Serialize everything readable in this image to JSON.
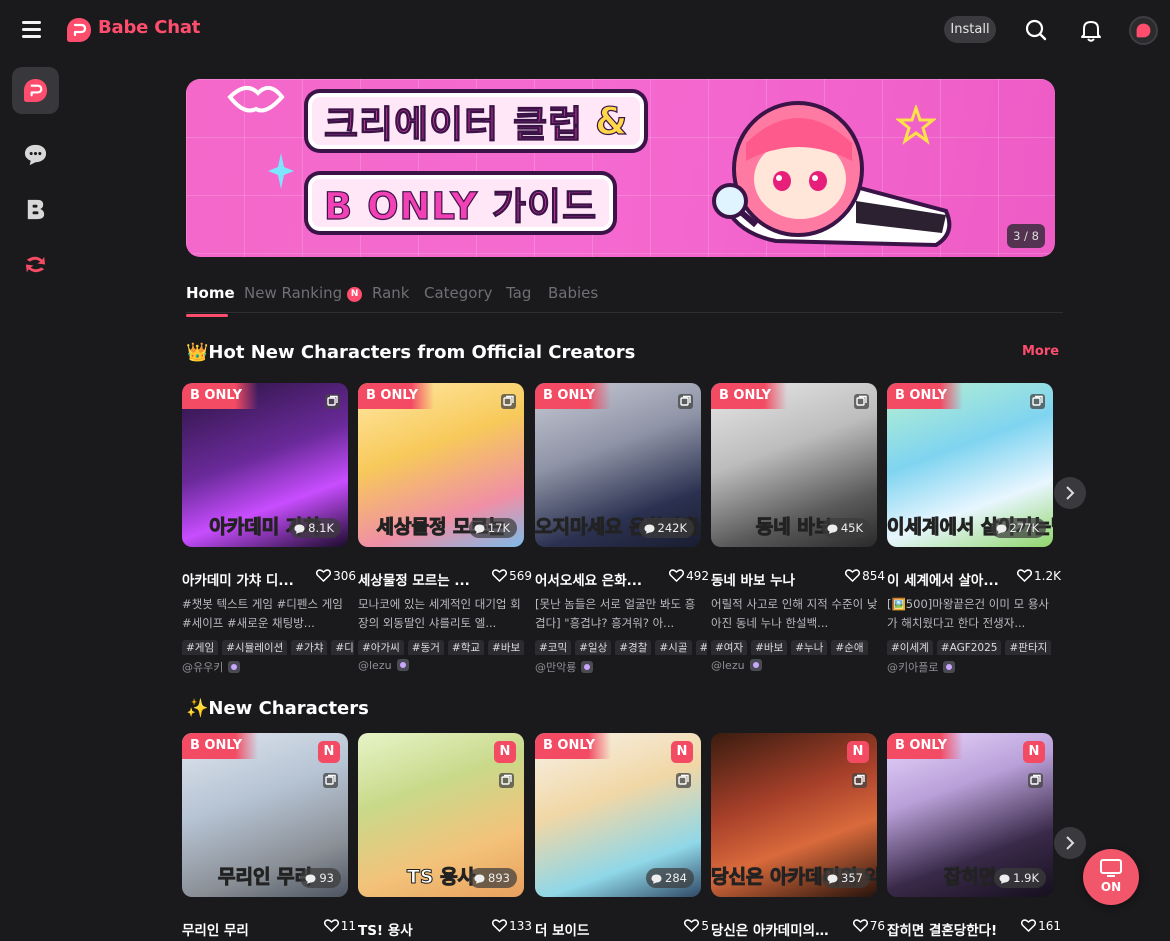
{
  "app": {
    "name": "Babe Chat",
    "install_label": "Install"
  },
  "banner": {
    "line1": "크리에이터 클럽",
    "amp": "&",
    "line2": "B ONLY 가이드",
    "counter": "3 / 8"
  },
  "tabs": [
    {
      "label": "Home",
      "active": true
    },
    {
      "label": "New Ranking",
      "badge": "N"
    },
    {
      "label": "Rank"
    },
    {
      "label": "Category"
    },
    {
      "label": "Tag"
    },
    {
      "label": "Babies"
    }
  ],
  "hot": {
    "title": "👑Hot New Characters from Official Creators",
    "more": "More",
    "cards": [
      {
        "bonly": "B ONLY",
        "caption": "아카데미 가챠",
        "chats": "8.1K",
        "title": "아카데미 가챠 디...",
        "likes": "306",
        "desc": "#챗봇 텍스트 게임 #디펜스 게임 #세이프 #새로운 채팅방...",
        "tags": [
          "#게임",
          "#시뮬레이션",
          "#가챠",
          "#디"
        ],
        "creator": "@유우키"
      },
      {
        "bonly": "B ONLY",
        "caption": "세상물정 모르는",
        "chats": "17K",
        "title": "세상물정 모르는 ...",
        "likes": "569",
        "desc": "모나코에 있는 세계적인 대기업 회장의 외동딸인 샤를리토 엘...",
        "tags": [
          "#아가씨",
          "#동거",
          "#학교",
          "#바보"
        ],
        "creator": "@lezu"
      },
      {
        "bonly": "B ONLY",
        "caption": "오지마세요 은화파출소",
        "chats": "242K",
        "title": "어서오세요 은화...",
        "likes": "492",
        "desc": "[못난 놈들은 서로 얼굴만 봐도 흥겹다] \"흥겹냐? 흥겨워? 아...",
        "tags": [
          "#코믹",
          "#일상",
          "#경찰",
          "#시골",
          "#"
        ],
        "creator": "@만악룡"
      },
      {
        "bonly": "B ONLY",
        "caption": "동네 바보",
        "chats": "45K",
        "title": "동네 바보 누나",
        "likes": "854",
        "desc": "어릴적 사고로 인해 지적 수준이 낮아진 동네 누나 한설백...",
        "tags": [
          "#여자",
          "#바보",
          "#누나",
          "#순애"
        ],
        "creator": "@lezu"
      },
      {
        "bonly": "B ONLY",
        "caption": "이세계에서 살아가는법",
        "chats": "277K",
        "title": "이 세계에서 살아...",
        "likes": "1.2K",
        "desc": "[🖼️500]마왕끝은건 이미 모 용사가 해치웠다고 한다 전생자...",
        "tags": [
          "#이세계",
          "#AGF2025",
          "#판타지"
        ],
        "creator": "@키아플로"
      }
    ]
  },
  "newchars": {
    "title": "✨New Characters",
    "cards": [
      {
        "bonly": "B ONLY",
        "new": "N",
        "caption": "무리인 무리",
        "chats": "93",
        "title": "무리인 무리",
        "likes": "11"
      },
      {
        "bonly": "",
        "new": "N",
        "caption": "TS 용사",
        "chats": "893",
        "title": "TS! 용사",
        "likes": "133"
      },
      {
        "bonly": "B ONLY",
        "new": "N",
        "caption": "",
        "chats": "284",
        "title": "더 보이드",
        "likes": "5"
      },
      {
        "bonly": "",
        "new": "N",
        "caption": "당신은 아카데미의 악역영애가 되었다",
        "chats": "357",
        "title": "당신은 아카데미의 ...",
        "likes": "76"
      },
      {
        "bonly": "B ONLY",
        "new": "N",
        "caption": "잡히면",
        "chats": "1.9K",
        "title": "잡히면 결혼당한다!",
        "likes": "161"
      }
    ]
  },
  "fab": {
    "label": "ON"
  },
  "colors": {
    "accent": "#ff4d6d",
    "background": "#1a1a1d",
    "banner": "#f56ad0"
  },
  "icons": {
    "menu": "hamburger-icon",
    "search": "search-icon",
    "bell": "bell-icon",
    "chat": "chat-bubble-icon",
    "next": "chevron-right-icon",
    "gallery": "gallery-icon",
    "heart": "heart-icon"
  }
}
